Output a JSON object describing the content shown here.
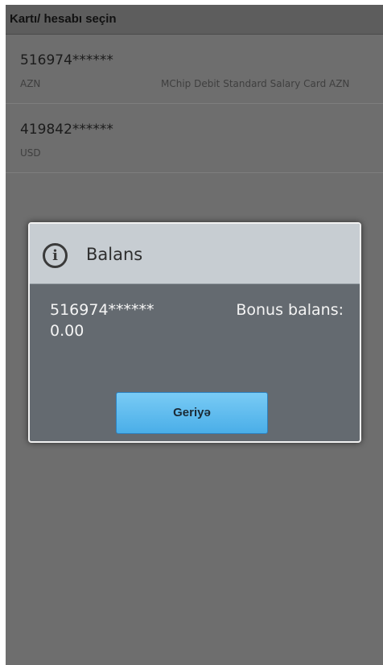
{
  "header": {
    "title": "Kartı/ hesabı seçin"
  },
  "accounts": [
    {
      "number": "516974******",
      "currency": "AZN",
      "type": "MChip Debit Standard Salary Card AZN"
    },
    {
      "number": "419842******",
      "currency": "USD",
      "type": ""
    }
  ],
  "dialog": {
    "icon": "info-icon",
    "title": "Balans",
    "card_number": "516974******",
    "bonus_label": "Bonus balans:",
    "bonus_value": "0.00",
    "back_button_label": "Geriyə"
  }
}
